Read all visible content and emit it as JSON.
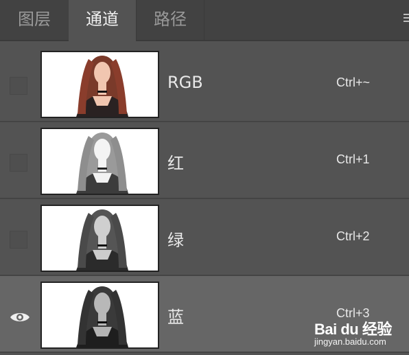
{
  "tabs": [
    {
      "label": "图层",
      "active": false
    },
    {
      "label": "通道",
      "active": true
    },
    {
      "label": "路径",
      "active": false
    }
  ],
  "menu_icon": "panel-menu-icon",
  "channels": [
    {
      "name": "RGB",
      "shortcut": "Ctrl+~",
      "visible": false,
      "selected": false,
      "thumb": "color"
    },
    {
      "name": "红",
      "shortcut": "Ctrl+1",
      "visible": false,
      "selected": false,
      "thumb": "light-gray"
    },
    {
      "name": "绿",
      "shortcut": "Ctrl+2",
      "visible": false,
      "selected": false,
      "thumb": "mid-gray"
    },
    {
      "name": "蓝",
      "shortcut": "Ctrl+3",
      "visible": true,
      "selected": true,
      "thumb": "dark-gray"
    }
  ],
  "watermark": {
    "brand": "Bai du 经验",
    "sub": "jingyan.baidu.com"
  },
  "colors": {
    "panel": "#535353",
    "tabbar": "#424242",
    "selected_row": "#666666",
    "text": "#e8e8e8"
  }
}
